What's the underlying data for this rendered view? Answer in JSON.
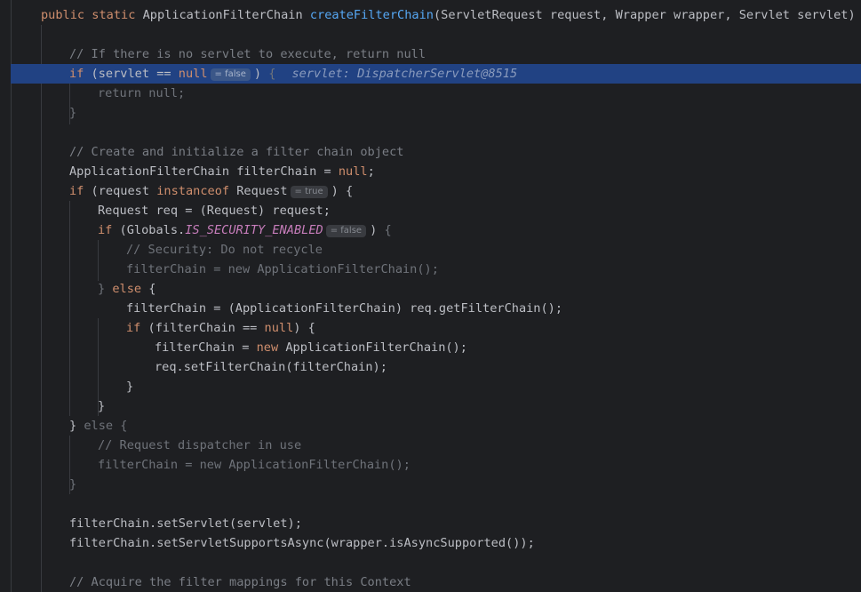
{
  "editor": {
    "lines": [
      {
        "parts": [
          {
            "t": "public static ",
            "c": "kw"
          },
          {
            "t": "ApplicationFilterChain "
          },
          {
            "t": "createFilterChain",
            "c": "fn"
          },
          {
            "t": "(ServletRequest request, Wrapper wrapper, Servlet servlet) {"
          }
        ]
      },
      {
        "parts": []
      },
      {
        "parts": [
          {
            "t": "// If there is no servlet to execute, return null",
            "c": "cm"
          }
        ]
      },
      {
        "current": true,
        "parts": [
          {
            "t": "if",
            "c": "kw"
          },
          {
            "t": " (servlet == "
          },
          {
            "t": "null",
            "c": "kw"
          },
          {
            "hint": "= false"
          },
          {
            "t": ") "
          },
          {
            "t": "{",
            "c": "dim"
          },
          {
            "inline": "servlet: DispatcherServlet@8515"
          }
        ]
      },
      {
        "parts": [
          {
            "t": "return null;",
            "c": "dim"
          }
        ]
      },
      {
        "parts": [
          {
            "t": "}",
            "c": "dim"
          }
        ]
      },
      {
        "parts": []
      },
      {
        "parts": [
          {
            "t": "// Create and initialize a filter chain object",
            "c": "cm"
          }
        ]
      },
      {
        "parts": [
          {
            "t": "ApplicationFilterChain filterChain = "
          },
          {
            "t": "null",
            "c": "kw"
          },
          {
            "t": ";"
          }
        ]
      },
      {
        "parts": [
          {
            "t": "if",
            "c": "kw"
          },
          {
            "t": " (request "
          },
          {
            "t": "instanceof",
            "c": "kw"
          },
          {
            "t": " Request"
          },
          {
            "hint": "= true"
          },
          {
            "t": ") {"
          }
        ]
      },
      {
        "parts": [
          {
            "t": "Request req = (Request) request;"
          }
        ]
      },
      {
        "parts": [
          {
            "t": "if",
            "c": "kw"
          },
          {
            "t": " (Globals."
          },
          {
            "t": "IS_SECURITY_ENABLED",
            "c": "cst"
          },
          {
            "hint": "= false"
          },
          {
            "t": ") "
          },
          {
            "t": "{",
            "c": "dim"
          }
        ]
      },
      {
        "parts": [
          {
            "t": "// Security: Do not recycle",
            "c": "dim"
          }
        ]
      },
      {
        "parts": [
          {
            "t": "filterChain = new ApplicationFilterChain();",
            "c": "dim"
          }
        ]
      },
      {
        "parts": [
          {
            "t": "}",
            "c": "dim"
          },
          {
            "t": " "
          },
          {
            "t": "else",
            "c": "kw"
          },
          {
            "t": " {"
          }
        ]
      },
      {
        "parts": [
          {
            "t": "filterChain = (ApplicationFilterChain) req.getFilterChain();"
          }
        ]
      },
      {
        "parts": [
          {
            "t": "if",
            "c": "kw"
          },
          {
            "t": " (filterChain == "
          },
          {
            "t": "null",
            "c": "kw"
          },
          {
            "t": ") {"
          }
        ]
      },
      {
        "parts": [
          {
            "t": "filterChain = "
          },
          {
            "t": "new",
            "c": "kw"
          },
          {
            "t": " ApplicationFilterChain();"
          }
        ]
      },
      {
        "parts": [
          {
            "t": "req.setFilterChain(filterChain);"
          }
        ]
      },
      {
        "parts": [
          {
            "t": "}"
          }
        ]
      },
      {
        "parts": [
          {
            "t": "}"
          }
        ]
      },
      {
        "parts": [
          {
            "t": "} "
          },
          {
            "t": "else {",
            "c": "dim"
          }
        ]
      },
      {
        "parts": [
          {
            "t": "// Request dispatcher in use",
            "c": "dim"
          }
        ]
      },
      {
        "parts": [
          {
            "t": "filterChain = new ApplicationFilterChain();",
            "c": "dim"
          }
        ]
      },
      {
        "parts": [
          {
            "t": "}",
            "c": "dim"
          }
        ]
      },
      {
        "parts": []
      },
      {
        "parts": [
          {
            "t": "filterChain.setServlet(servlet);"
          }
        ]
      },
      {
        "parts": [
          {
            "t": "filterChain.setServletSupportsAsync(wrapper.isAsyncSupported());"
          }
        ]
      },
      {
        "parts": []
      },
      {
        "parts": [
          {
            "t": "// Acquire the filter mappings for this Context",
            "c": "cm"
          }
        ]
      }
    ]
  }
}
